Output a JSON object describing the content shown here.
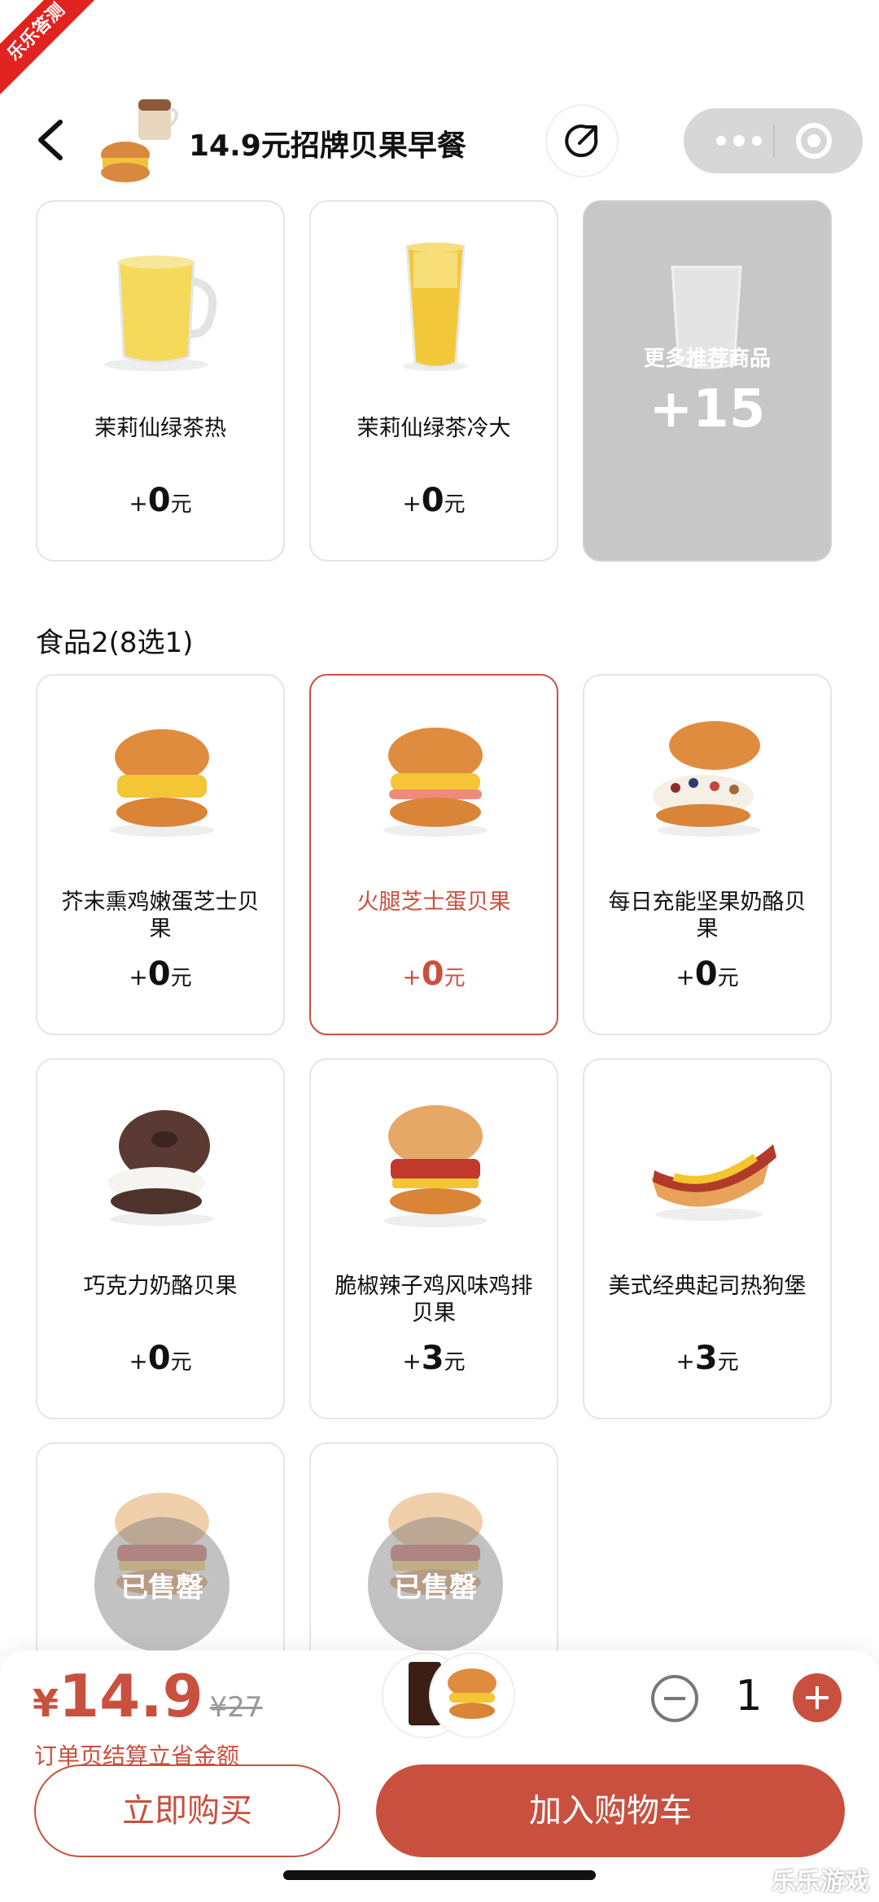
{
  "watermark": {
    "ribbon": "乐乐答测",
    "corner": "乐乐游戏"
  },
  "header": {
    "title": "14.9元招牌贝果早餐"
  },
  "drinks": [
    {
      "name": "茉莉仙绿茶热",
      "plus": "+",
      "price": "0",
      "unit": "元"
    },
    {
      "name": "茉莉仙绿茶冷大",
      "plus": "+",
      "price": "0",
      "unit": "元"
    }
  ],
  "more": {
    "label": "更多推荐商品",
    "count": "+15"
  },
  "section": {
    "title": "食品2(8选1)"
  },
  "foods": [
    {
      "name": "芥末熏鸡嫩蛋芝士贝果",
      "plus": "+",
      "price": "0",
      "unit": "元"
    },
    {
      "name": "火腿芝士蛋贝果",
      "plus": "+",
      "price": "0",
      "unit": "元",
      "selected": true
    },
    {
      "name": "每日充能坚果奶酪贝果",
      "plus": "+",
      "price": "0",
      "unit": "元"
    },
    {
      "name": "巧克力奶酪贝果",
      "plus": "+",
      "price": "0",
      "unit": "元"
    },
    {
      "name": "脆椒辣子鸡风味鸡排贝果",
      "plus": "+",
      "price": "3",
      "unit": "元"
    },
    {
      "name": "美式经典起司热狗堡",
      "plus": "+",
      "price": "3",
      "unit": "元"
    }
  ],
  "soldout": {
    "label": "已售罄"
  },
  "bottom": {
    "currency": "¥",
    "price": "14.9",
    "original": "¥27",
    "saving": "订单页结算立省金额",
    "quantity": "1",
    "buy_now": "立即购买",
    "add_cart": "加入购物车"
  },
  "colors": {
    "accent": "#c9503f",
    "more_bg": "#c7c7c7"
  }
}
